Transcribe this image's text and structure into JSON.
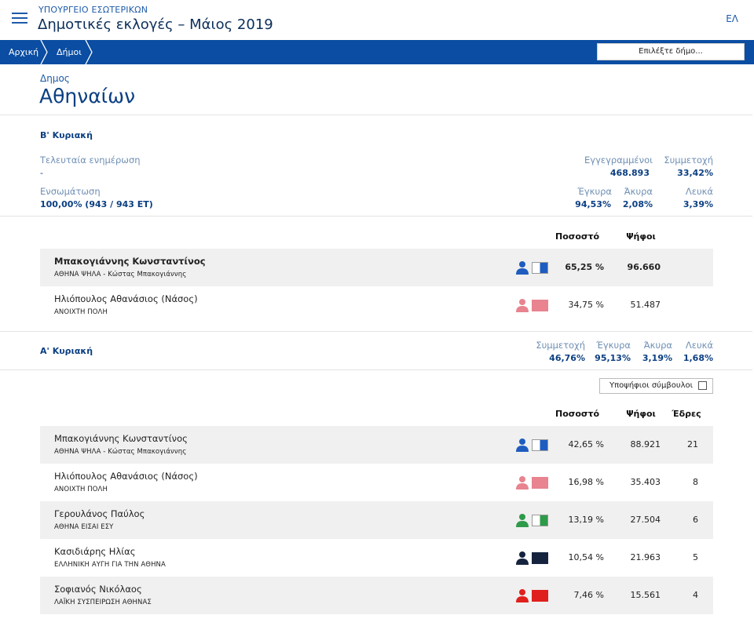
{
  "header": {
    "ministry": "ΥΠΟΥΡΓΕΙΟ ΕΣΩΤΕΡΙΚΩΝ",
    "title": "Δημοτικές εκλογές – Μάιος 2019",
    "lang": "ΕΛ"
  },
  "breadcrumb": {
    "items": [
      "Αρχική",
      "Δήμοι"
    ],
    "select_placeholder": "Επιλέξτε δήμο..."
  },
  "municipality": {
    "label": "Δημος",
    "name": "Αθηναίων"
  },
  "round_b": {
    "title": "Β' Κυριακή",
    "last_update_label": "Τελευταία ενημέρωση",
    "last_update_value": "-",
    "incorporation_label": "Ενσωμάτωση",
    "incorporation_value": "100,00% (943 / 943 ΕΤ)",
    "registered_label": "Εγγεγραμμένοι",
    "registered_value": "468.893",
    "turnout_label": "Συμμετοχή",
    "turnout_value": "33,42%",
    "valid_label": "Έγκυρα",
    "valid_value": "94,53%",
    "invalid_label": "Άκυρα",
    "invalid_value": "2,08%",
    "blank_label": "Λευκά",
    "blank_value": "3,39%",
    "col_percent": "Ποσοστό",
    "col_votes": "Ψήφοι",
    "rows": [
      {
        "candidate": "Μπακογιάννης Κωνσταντίνος",
        "party": "ΑΘΗΝΑ ΨΗΛΑ - Κώστας Μπακογιάννης",
        "percent": "65,25 %",
        "votes": "96.660",
        "color": "#1f5cbf"
      },
      {
        "candidate": "Ηλιόπουλος Αθανάσιος (Νάσος)",
        "party": "ΑΝΟΙΧΤΗ ΠΟΛΗ",
        "percent": "34,75 %",
        "votes": "51.487",
        "color": "#e8838f"
      }
    ]
  },
  "round_a": {
    "title": "Α' Κυριακή",
    "turnout_label": "Συμμετοχή",
    "turnout_value": "46,76%",
    "valid_label": "Έγκυρα",
    "valid_value": "95,13%",
    "invalid_label": "Άκυρα",
    "invalid_value": "3,19%",
    "blank_label": "Λευκά",
    "blank_value": "1,68%",
    "councillors_label": "Υποψήφιοι σύμβουλοι",
    "col_percent": "Ποσοστό",
    "col_votes": "Ψήφοι",
    "col_seats": "Έδρες",
    "rows": [
      {
        "candidate": "Μπακογιάννης Κωνσταντίνος",
        "party": "ΑΘΗΝΑ ΨΗΛΑ - Κώστας Μπακογιάννης",
        "percent": "42,65 %",
        "votes": "88.921",
        "seats": "21",
        "color": "#1f5cbf"
      },
      {
        "candidate": "Ηλιόπουλος Αθανάσιος (Νάσος)",
        "party": "ΑΝΟΙΧΤΗ ΠΟΛΗ",
        "percent": "16,98 %",
        "votes": "35.403",
        "seats": "8",
        "color": "#e8838f"
      },
      {
        "candidate": "Γερουλάνος Παύλος",
        "party": "ΑΘΗΝΑ ΕΙΣΑΙ ΕΣΥ",
        "percent": "13,19 %",
        "votes": "27.504",
        "seats": "6",
        "color": "#2e9a4a"
      },
      {
        "candidate": "Κασιδιάρης Ηλίας",
        "party": "ΕΛΛΗΝΙΚΗ ΑΥΓΗ ΓΙΑ ΤΗΝ ΑΘΗΝΑ",
        "percent": "10,54 %",
        "votes": "21.963",
        "seats": "5",
        "color": "#16233f"
      },
      {
        "candidate": "Σοφιανός Νικόλαος",
        "party": "ΛΑΪΚΗ ΣΥΣΠΕΙΡΩΣΗ ΑΘΗΝΑΣ",
        "percent": "7,46 %",
        "votes": "15.561",
        "seats": "4",
        "color": "#e0201c"
      }
    ]
  }
}
